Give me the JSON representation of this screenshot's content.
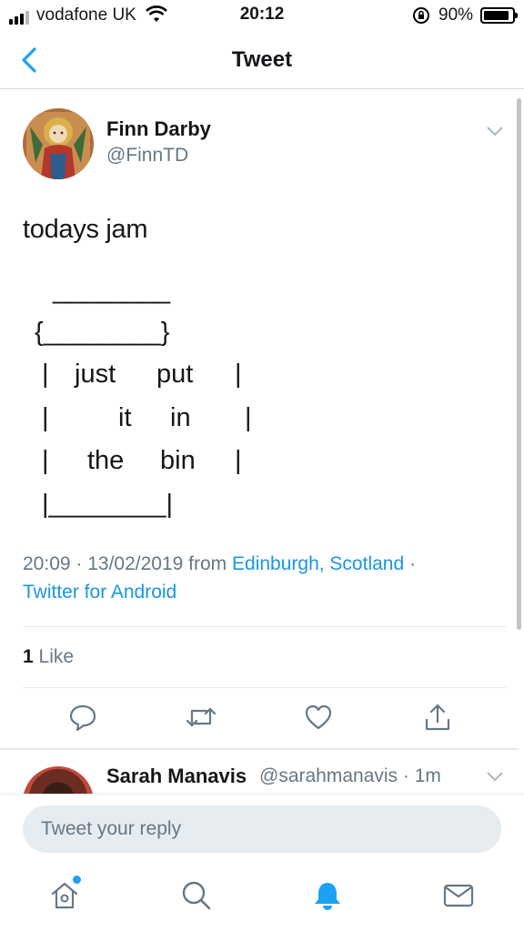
{
  "status_bar": {
    "carrier": "vodafone UK",
    "time": "20:12",
    "battery_percent": "90%",
    "battery_level": 0.9
  },
  "nav": {
    "title": "Tweet",
    "back_icon": "chevron-left-icon"
  },
  "tweet": {
    "author_name": "Finn Darby",
    "author_handle": "@FinnTD",
    "text_intro": "todays jam",
    "art_lines": {
      "line1": "________",
      "line2": "{________}",
      "line3a": "|",
      "line3b": "just",
      "line3c": "put",
      "line3d": "|",
      "line4a": "|",
      "line4b": "it",
      "line4c": "in",
      "line4d": "|",
      "line5a": "|",
      "line5b": "the",
      "line5c": "bin",
      "line5d": "|",
      "line6": "|________|"
    },
    "timestamp": "20:09 · 13/02/2019",
    "from_label": "from",
    "location": "Edinburgh, Scotland",
    "separator": "·",
    "source": "Twitter for Android",
    "like_count": "1",
    "like_label": "Like"
  },
  "actions": [
    "reply-icon",
    "retweet-icon",
    "like-icon",
    "share-icon"
  ],
  "reply_preview": {
    "name": "Sarah Manavis",
    "handle_time": "@sarahmanavis · 1m"
  },
  "composer": {
    "placeholder": "Tweet your reply"
  },
  "tab_bar": [
    "home-icon",
    "search-icon",
    "notifications-icon",
    "messages-icon"
  ],
  "colors": {
    "accent": "#1da1f2",
    "link": "#1b95e0",
    "secondary_text": "#657786"
  }
}
